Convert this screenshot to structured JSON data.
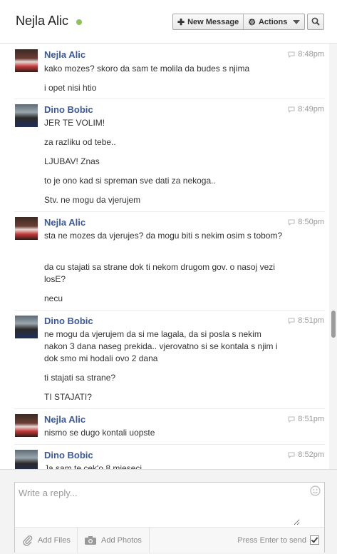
{
  "header": {
    "name": "Nejla Alic",
    "new_message": "New Message",
    "actions": "Actions"
  },
  "groups": [
    {
      "sender": "Nejla Alic",
      "avatar": "nejla",
      "time": "8:48pm",
      "messages": [
        "kako mozes? skoro da sam te molila da budes s njima",
        "i opet nisi htio"
      ]
    },
    {
      "sender": "Dino Bobic",
      "avatar": "dino",
      "time": "8:49pm",
      "messages": [
        "JER TE VOLIM!",
        "za razliku od tebe..",
        "LJUBAV! Znas",
        "to je ono kad si spreman sve dati za nekoga..",
        "Stv. ne mogu da vjerujem"
      ]
    },
    {
      "sender": "Nejla Alic",
      "avatar": "nejla",
      "time": "8:50pm",
      "messages": [
        "sta ne mozes da vjerujes? da mogu biti s nekim osim s tobom?",
        "da cu stajati sa strane dok ti nekom drugom gov. o nasoj vezi losE?",
        "necu"
      ]
    },
    {
      "sender": "Dino Bobic",
      "avatar": "dino",
      "time": "8:51pm",
      "messages": [
        "ne mogu da vjerujem da si me lagala, da si posla s nekim nakon 3 dana naseg prekida.. vjerovatno si se kontala s njim i dok smo mi hodali ovo 2 dana",
        "ti stajati sa strane?",
        "TI STAJATI?"
      ]
    },
    {
      "sender": "Nejla Alic",
      "avatar": "nejla",
      "time": "8:51pm",
      "messages": [
        "nismo se dugo kontali uopste"
      ]
    },
    {
      "sender": "Dino Bobic",
      "avatar": "dino",
      "time": "8:52pm",
      "messages": [
        "Ja sam te cek'o 8 mjeseci"
      ]
    }
  ],
  "composer": {
    "placeholder": "Write a reply...",
    "add_files": "Add Files",
    "add_photos": "Add Photos",
    "press_enter": "Press Enter to send"
  },
  "colors": {
    "name_link": "#3b5998",
    "online": "#8fc15f"
  }
}
